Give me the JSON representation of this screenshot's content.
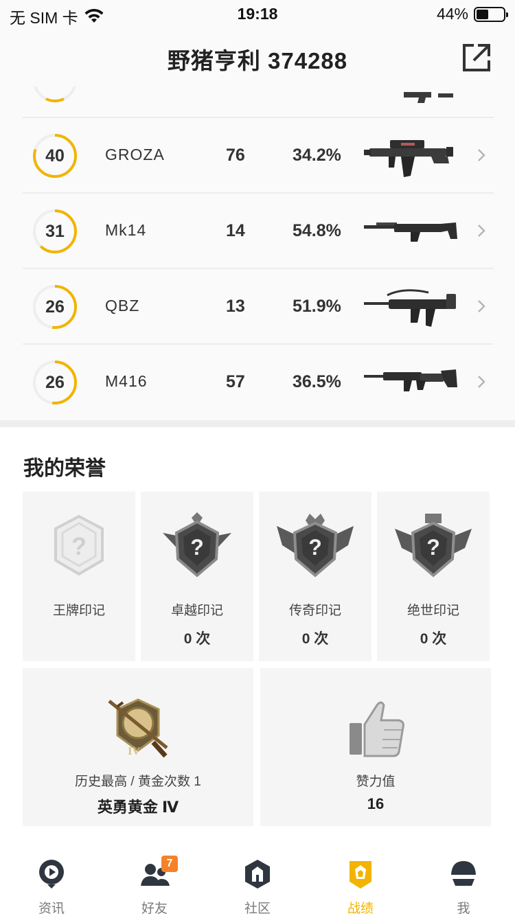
{
  "status_bar": {
    "carrier": "无 SIM 卡",
    "time": "19:18",
    "battery_text": "44%",
    "battery_level": 0.44
  },
  "header": {
    "title": "野猪亨利 374288"
  },
  "weapons": [
    {
      "level": "40",
      "level_fraction": 0.8,
      "name": "GROZA",
      "count": "76",
      "percent": "34.2%",
      "gun_icon": "groza-rifle-icon"
    },
    {
      "level": "31",
      "level_fraction": 0.62,
      "name": "Mk14",
      "count": "14",
      "percent": "54.8%",
      "gun_icon": "mk14-rifle-icon"
    },
    {
      "level": "26",
      "level_fraction": 0.52,
      "name": "QBZ",
      "count": "13",
      "percent": "51.9%",
      "gun_icon": "qbz-rifle-icon"
    },
    {
      "level": "26",
      "level_fraction": 0.52,
      "name": "M416",
      "count": "57",
      "percent": "36.5%",
      "gun_icon": "m416-rifle-icon"
    }
  ],
  "honors": {
    "title": "我的荣誉",
    "badges": [
      {
        "label": "王牌印记",
        "count": ""
      },
      {
        "label": "卓越印记",
        "count": "0 次"
      },
      {
        "label": "传奇印记",
        "count": "0 次"
      },
      {
        "label": "绝世印记",
        "count": "0 次"
      }
    ],
    "rank": {
      "label": "历史最高 / 黄金次数 1",
      "value": "英勇黄金 Ⅳ"
    },
    "likes": {
      "label": "赞力值",
      "value": "16"
    }
  },
  "tabs": [
    {
      "label": "资讯",
      "icon": "news-icon",
      "active": false
    },
    {
      "label": "好友",
      "icon": "friends-icon",
      "active": false,
      "badge": "7"
    },
    {
      "label": "社区",
      "icon": "community-icon",
      "active": false
    },
    {
      "label": "战绩",
      "icon": "record-icon",
      "active": true
    },
    {
      "label": "我",
      "icon": "profile-helmet-icon",
      "active": false
    }
  ],
  "colors": {
    "accent": "#f2b400",
    "ring_track": "#eeeeee",
    "badge": "#f5822a"
  }
}
